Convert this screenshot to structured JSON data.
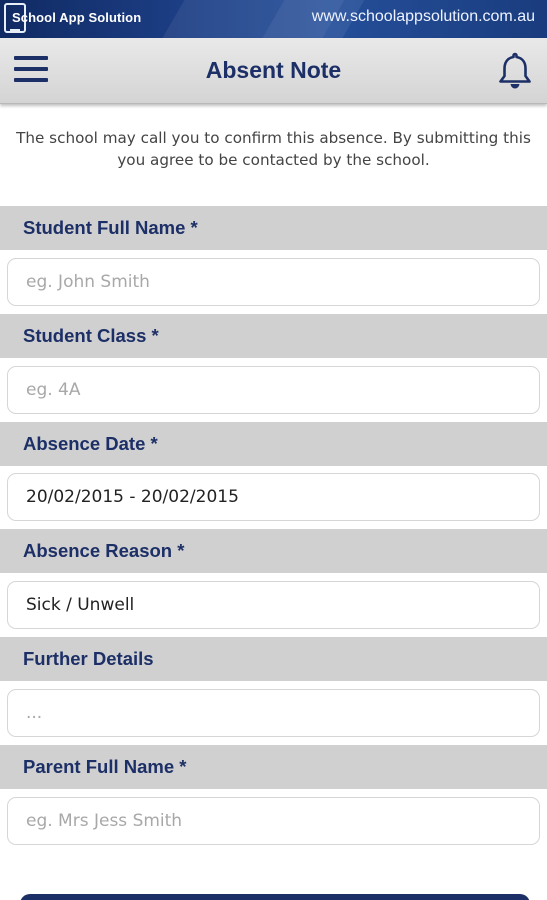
{
  "banner": {
    "brand": "School App Solution",
    "url": "www.schoolappsolution.com.au"
  },
  "appbar": {
    "title": "Absent Note",
    "menu_icon": "hamburger-menu-icon",
    "bell_icon": "bell-icon"
  },
  "intro_text": "The school may call you to confirm this absence. By submitting this you agree to be contacted by the school.",
  "form": {
    "student_name": {
      "label": "Student Full Name *",
      "placeholder": "eg. John Smith",
      "value": ""
    },
    "student_class": {
      "label": "Student Class *",
      "placeholder": "eg. 4A",
      "value": ""
    },
    "absence_date": {
      "label": "Absence Date *",
      "value": "20/02/2015 - 20/02/2015"
    },
    "absence_reason": {
      "label": "Absence Reason *",
      "value": "Sick / Unwell"
    },
    "further_details": {
      "label": "Further Details",
      "placeholder": "...",
      "value": ""
    },
    "parent_name": {
      "label": "Parent Full Name *",
      "placeholder": "eg. Mrs Jess Smith",
      "value": ""
    }
  },
  "colors": {
    "primary": "#1c2f66",
    "section_bg": "#d0d0d0",
    "appbar_bg": "#e0e0e0",
    "placeholder": "#a8a8a8"
  }
}
